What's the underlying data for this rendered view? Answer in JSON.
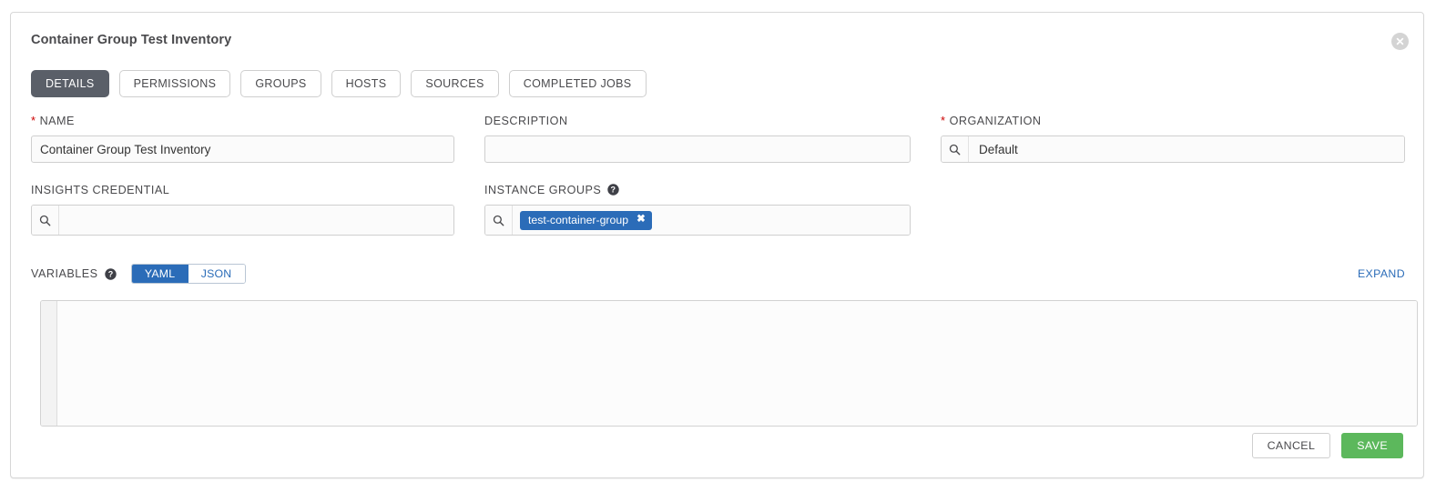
{
  "card": {
    "title": "Container Group Test Inventory",
    "close_icon": "close-circle-icon"
  },
  "tabs": [
    {
      "label": "DETAILS",
      "active": true
    },
    {
      "label": "PERMISSIONS",
      "active": false
    },
    {
      "label": "GROUPS",
      "active": false
    },
    {
      "label": "HOSTS",
      "active": false
    },
    {
      "label": "SOURCES",
      "active": false
    },
    {
      "label": "COMPLETED JOBS",
      "active": false
    }
  ],
  "fields": {
    "name": {
      "label": "NAME",
      "required": true,
      "value": "Container Group Test Inventory",
      "placeholder": ""
    },
    "description": {
      "label": "DESCRIPTION",
      "required": false,
      "value": "",
      "placeholder": ""
    },
    "organization": {
      "label": "ORGANIZATION",
      "required": true,
      "value": "Default",
      "placeholder": "",
      "search_icon": "search-icon"
    },
    "insights_credential": {
      "label": "INSIGHTS CREDENTIAL",
      "required": false,
      "value": "",
      "placeholder": "",
      "search_icon": "search-icon"
    },
    "instance_groups": {
      "label": "INSTANCE GROUPS",
      "required": false,
      "help_icon": "help-circle-icon",
      "search_icon": "search-icon",
      "chips": [
        {
          "label": "test-container-group",
          "remove_icon": "times-icon"
        }
      ]
    }
  },
  "variables": {
    "label": "VARIABLES",
    "help_icon": "help-circle-icon",
    "formats": [
      {
        "label": "YAML",
        "selected": true
      },
      {
        "label": "JSON",
        "selected": false
      }
    ],
    "expand_label": "EXPAND",
    "value": ""
  },
  "footer": {
    "cancel_label": "CANCEL",
    "save_label": "SAVE"
  },
  "colors": {
    "accent_blue": "#2b6cb8",
    "save_green": "#5cb85c",
    "active_tab": "#5a5f68",
    "required_red": "#cc0000"
  }
}
